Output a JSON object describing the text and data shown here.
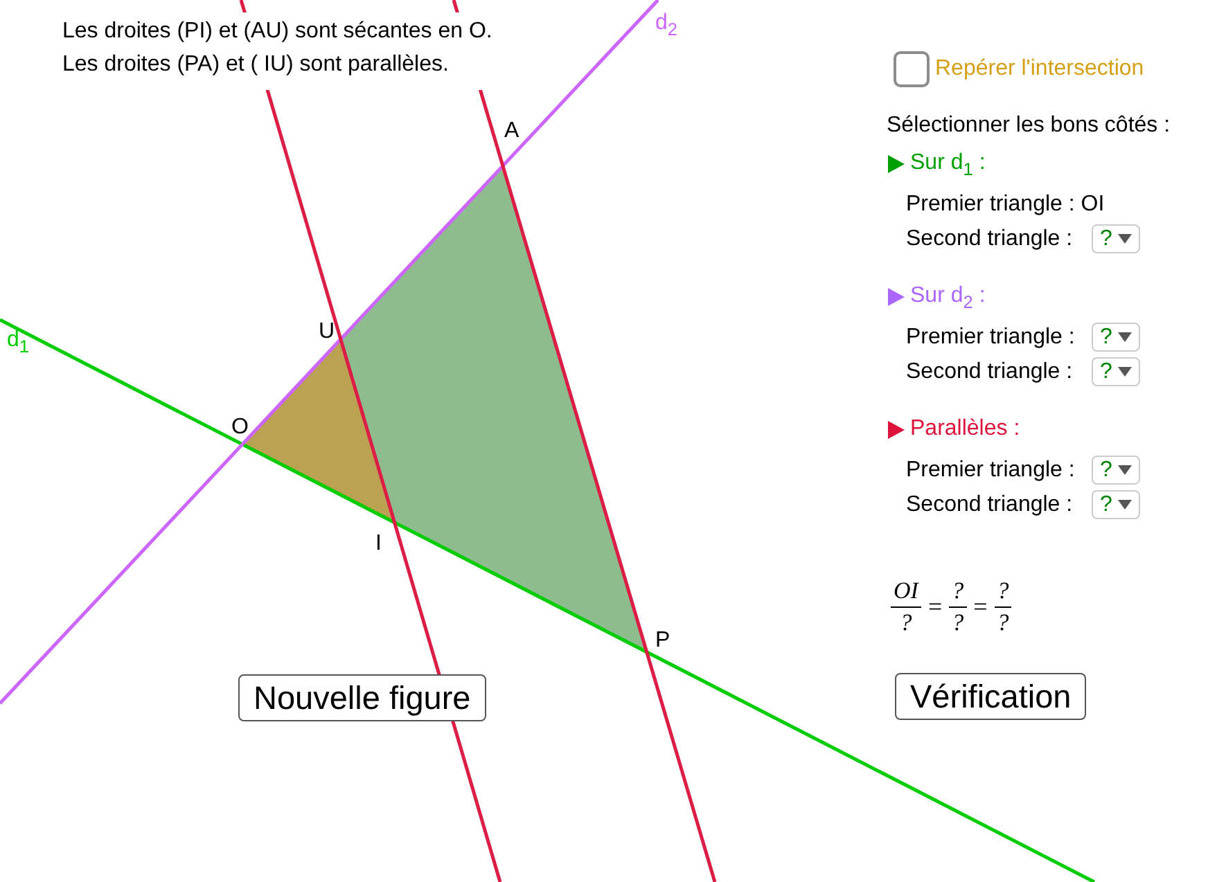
{
  "statement": [
    "Les droites (PI) et (AU) sont sécantes en O.",
    "Les droites (PA) et ( IU) sont parallèles."
  ],
  "figure": {
    "lines": [
      {
        "label": "d$_{1}$",
        "color": "#00cc00"
      },
      {
        "label": "d$_{2}$",
        "color": "#cc66ff"
      },
      {
        "color": "#dc1e46"
      },
      {
        "color": "#dc1e46"
      }
    ],
    "points": [
      "A",
      "U",
      "O",
      "I",
      "P"
    ]
  },
  "checkbox": {
    "label": "Repérer l'intersection",
    "checked": false
  },
  "instruction": "Sélectionner les bons côtés :",
  "sections": [
    {
      "title": "Sur d$_{1}$ :",
      "color": "#00a000",
      "rows": [
        {
          "kind": "text",
          "label": "Premier triangle : OI"
        },
        {
          "kind": "dropdown",
          "label": "Second triangle :",
          "value": "?"
        }
      ]
    },
    {
      "title": "Sur d$_{2}$ :",
      "color": "#aa66ff",
      "rows": [
        {
          "kind": "dropdown",
          "label": "Premier triangle :",
          "value": "?"
        },
        {
          "kind": "dropdown",
          "label": "Second triangle :",
          "value": "?"
        }
      ]
    },
    {
      "title": "Parallèles :",
      "color": "#dc143c",
      "rows": [
        {
          "kind": "dropdown",
          "label": "Premier triangle :",
          "value": "?"
        },
        {
          "kind": "dropdown",
          "label": "Second triangle :",
          "value": "?"
        }
      ]
    }
  ],
  "formula": [
    {
      "kind": "fraction",
      "numerator": "OI",
      "denominator": "?"
    },
    {
      "kind": "operator",
      "text": "="
    },
    {
      "kind": "fraction",
      "numerator": "?",
      "denominator": "?"
    },
    {
      "kind": "operator",
      "text": "="
    },
    {
      "kind": "fraction",
      "numerator": "?",
      "denominator": "?"
    }
  ],
  "new_figure_button": "Nouvelle figure",
  "check_button": "Vérification"
}
